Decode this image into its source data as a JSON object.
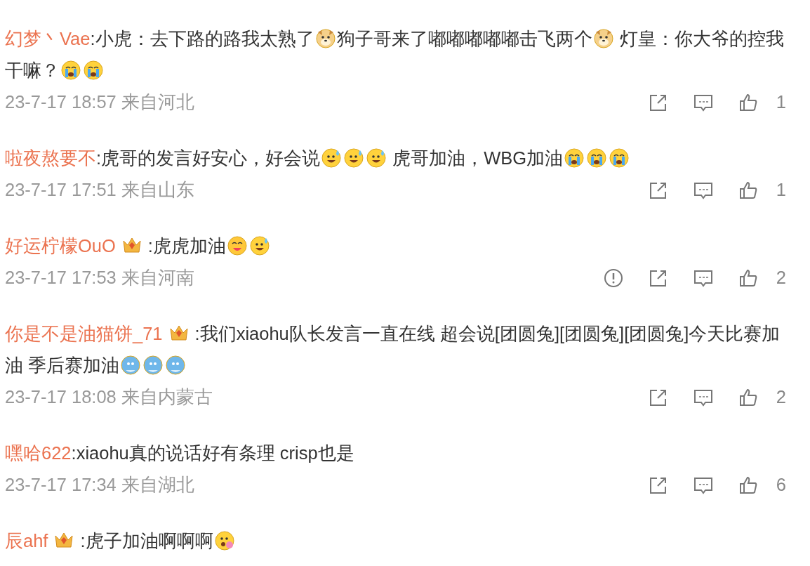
{
  "comments": [
    {
      "user": "幻梦丶Vae",
      "badge": false,
      "body": [
        {
          "kind": "text",
          "text": ":小虎：去下路的路我太熟了"
        },
        {
          "kind": "dog"
        },
        {
          "kind": "text",
          "text": "狗子哥来了嘟嘟嘟嘟嘟击飞两个"
        },
        {
          "kind": "dog"
        },
        {
          "kind": "text",
          "text": " 灯皇：你大爷的控我干嘛？"
        },
        {
          "kind": "crying"
        },
        {
          "kind": "crying"
        }
      ],
      "time": "23-7-17 18:57 来自河北",
      "report": false,
      "likes": "1"
    },
    {
      "user": "啦夜熬要不",
      "badge": false,
      "body": [
        {
          "kind": "text",
          "text": ":虎哥的发言好安心，好会说"
        },
        {
          "kind": "sweat"
        },
        {
          "kind": "sweat"
        },
        {
          "kind": "sweat"
        },
        {
          "kind": "text",
          "text": " 虎哥加油，WBG加油"
        },
        {
          "kind": "crying"
        },
        {
          "kind": "crying"
        },
        {
          "kind": "crying"
        }
      ],
      "time": "23-7-17 17:51 来自山东",
      "report": false,
      "likes": "1"
    },
    {
      "user": "好运柠檬OuO",
      "badge": true,
      "body": [
        {
          "kind": "text",
          "text": ":虎虎加油"
        },
        {
          "kind": "love"
        },
        {
          "kind": "sweat"
        }
      ],
      "time": "23-7-17 17:53 来自河南",
      "report": true,
      "likes": "2"
    },
    {
      "user": "你是不是油猫饼_71",
      "badge": true,
      "body": [
        {
          "kind": "text",
          "text": ":我们xiaohu队长发言一直在线 超会说[团圆兔][团圆兔][团圆兔]今天比赛加油 季后赛加油"
        },
        {
          "kind": "blue"
        },
        {
          "kind": "blue"
        },
        {
          "kind": "blue"
        }
      ],
      "time": "23-7-17 18:08 来自内蒙古",
      "report": false,
      "likes": "2"
    },
    {
      "user": "嘿哈622",
      "badge": false,
      "body": [
        {
          "kind": "text",
          "text": ":xiaohu真的说话好有条理 crisp也是"
        }
      ],
      "time": "23-7-17 17:34 来自湖北",
      "report": false,
      "likes": "6"
    },
    {
      "user": "辰ahf",
      "badge": true,
      "body": [
        {
          "kind": "text",
          "text": ":虎子加油啊啊啊"
        },
        {
          "kind": "flower"
        }
      ]
    }
  ]
}
